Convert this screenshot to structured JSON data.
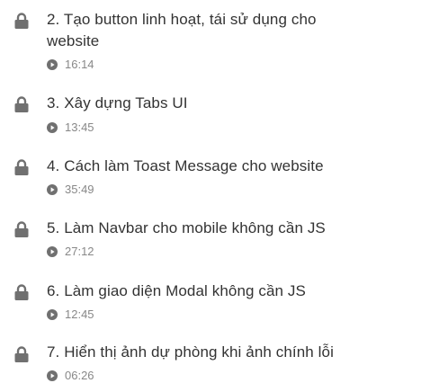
{
  "lessons": [
    {
      "title_line1": "2. Tạo button linh hoạt, tái sử dụng cho",
      "title_line2": "website",
      "duration": "16:14",
      "locked": true
    },
    {
      "title": "3. Xây dựng Tabs UI",
      "duration": "13:45",
      "locked": true
    },
    {
      "title": "4. Cách làm Toast Message cho website",
      "duration": "35:49",
      "locked": true
    },
    {
      "title": "5. Làm Navbar cho mobile không cần JS",
      "duration": "27:12",
      "locked": true
    },
    {
      "title": "6. Làm giao diện Modal không cần JS",
      "duration": "12:45",
      "locked": true
    },
    {
      "title": "7. Hiển thị ảnh dự phòng khi ảnh chính lỗi",
      "duration": "06:26",
      "locked": true
    }
  ],
  "icons": {
    "lock": "lock-icon",
    "play": "play-circle-icon"
  },
  "colors": {
    "text": "#333333",
    "muted": "#888888",
    "icon": "#707070"
  }
}
